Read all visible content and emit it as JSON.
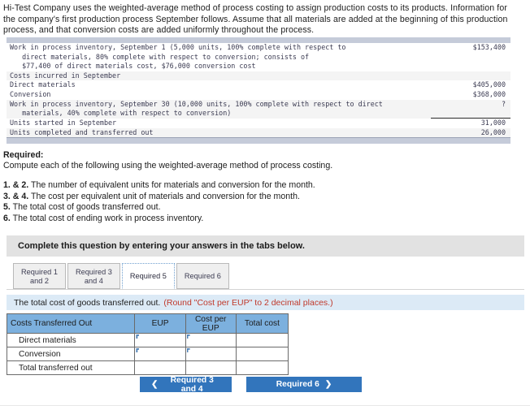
{
  "intro": {
    "paragraph": "Hi-Test Company uses the weighted-average method of process costing to assign production costs to its products. Information for the company's first production process September follows. Assume that all materials are added at the beginning of this production process, and that conversion costs are added uniformly throughout the process."
  },
  "data_table": {
    "rows": [
      {
        "label": "Work in process inventory, September 1 (5,000 units, 100% complete with respect to\n   direct materials, 80% complete with respect to conversion; consists of\n   $77,400 of direct materials cost, $76,000 conversion cost",
        "value": "$153,400"
      },
      {
        "label": "Costs incurred in September",
        "value": ""
      },
      {
        "label": "Direct materials",
        "value": "$405,000"
      },
      {
        "label": "Conversion",
        "value": "$368,000"
      },
      {
        "label": "Work in process inventory, September 30 (10,000 units, 100% complete with respect to direct\n   materials, 40% complete with respect to conversion)",
        "value": "?"
      },
      {
        "label": "Units started in September",
        "value": "31,000"
      },
      {
        "label": "Units completed and transferred out",
        "value": "26,000"
      }
    ]
  },
  "required": {
    "heading": "Required:",
    "subheading": "Compute each of the following using the weighted-average method of process costing.",
    "items": [
      {
        "num": "1. & 2.",
        "text": " The number of equivalent units for materials and conversion for the month."
      },
      {
        "num": "3. & 4.",
        "text": " The cost per equivalent unit of materials and conversion for the month."
      },
      {
        "num": "5.",
        "text": " The total cost of goods transferred out."
      },
      {
        "num": "6.",
        "text": " The total cost of ending work in process inventory."
      }
    ]
  },
  "complete_banner": {
    "text": "Complete this question by entering your answers in the tabs below."
  },
  "tabs": [
    {
      "label": "Required 1\nand 2",
      "active": false
    },
    {
      "label": "Required 3\nand 4",
      "active": false
    },
    {
      "label": "Required 5",
      "active": true
    },
    {
      "label": "Required 6",
      "active": false
    }
  ],
  "instruction": {
    "main": "The total cost of goods transferred out.",
    "note": "(Round \"Cost per EUP\" to 2 decimal places.)"
  },
  "answer_table": {
    "headers": {
      "label": "Costs Transferred Out",
      "eup": "EUP",
      "cost_per_eup": "Cost per\nEUP",
      "total_cost": "Total cost"
    },
    "rows": [
      {
        "label": "Direct materials",
        "eup": "",
        "cost_per_eup": "",
        "total_cost": ""
      },
      {
        "label": "Conversion",
        "eup": "",
        "cost_per_eup": "",
        "total_cost": ""
      },
      {
        "label": "Total transferred out",
        "eup": "",
        "cost_per_eup": "",
        "total_cost": ""
      }
    ]
  },
  "nav": {
    "prev_label": "Required 3 and 4",
    "prev_icon": "chevron-left",
    "next_label": "Required 6",
    "next_icon": "chevron-right"
  },
  "colors": {
    "accent_blue": "#3275bc",
    "table_header_blue": "#7cb0de",
    "instruction_blue": "#dceaf6",
    "banner_grey": "#e2e2e2",
    "note_red": "#c0392b"
  }
}
